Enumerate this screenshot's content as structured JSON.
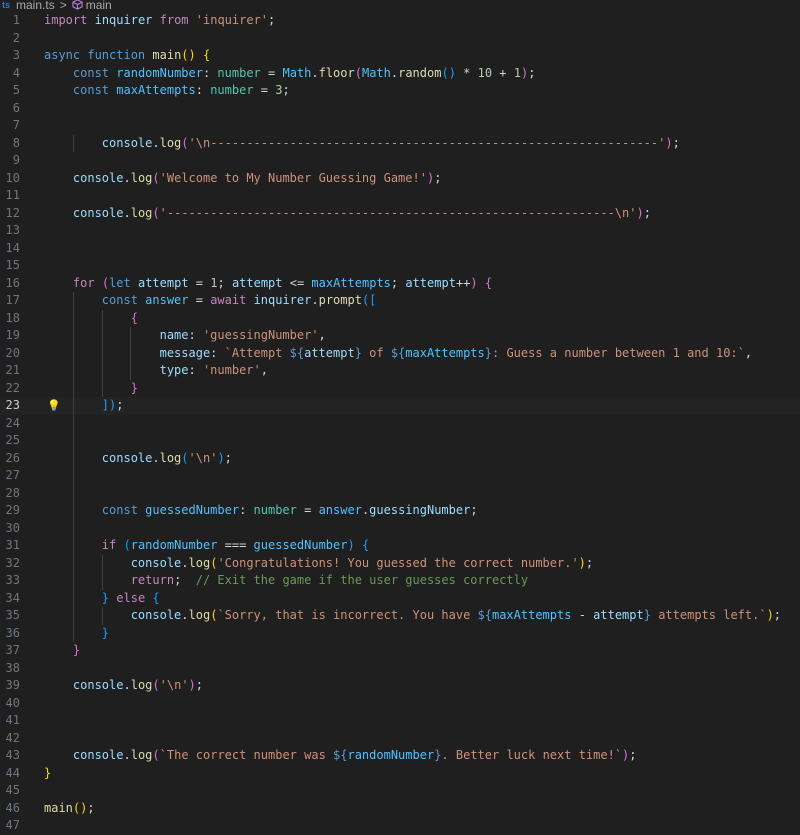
{
  "breadcrumb": {
    "file_icon": "ts",
    "file": "main.ts",
    "separator": ">",
    "symbol": "main"
  },
  "editor": {
    "current_line": 23,
    "lines": [
      {
        "n": "1",
        "tokens": [
          [
            "kw",
            "import"
          ],
          [
            "op",
            " "
          ],
          [
            "vr",
            "inquirer"
          ],
          [
            "op",
            " "
          ],
          [
            "kw",
            "from"
          ],
          [
            "op",
            " "
          ],
          [
            "str",
            "'inquirer'"
          ],
          [
            "op",
            ";"
          ]
        ]
      },
      {
        "n": "2",
        "tokens": []
      },
      {
        "n": "3",
        "tokens": [
          [
            "st",
            "async"
          ],
          [
            "op",
            " "
          ],
          [
            "st",
            "function"
          ],
          [
            "op",
            " "
          ],
          [
            "fn",
            "main"
          ],
          [
            "b1",
            "()"
          ],
          [
            "op",
            " "
          ],
          [
            "b1",
            "{"
          ]
        ]
      },
      {
        "n": "4",
        "tokens": [
          [
            "op",
            "    "
          ],
          [
            "st",
            "const"
          ],
          [
            "op",
            " "
          ],
          [
            "cn",
            "randomNumber"
          ],
          [
            "op",
            ": "
          ],
          [
            "ty",
            "number"
          ],
          [
            "op",
            " = "
          ],
          [
            "cn",
            "Math"
          ],
          [
            "op",
            "."
          ],
          [
            "fn",
            "floor"
          ],
          [
            "b2",
            "("
          ],
          [
            "cn",
            "Math"
          ],
          [
            "op",
            "."
          ],
          [
            "fn",
            "random"
          ],
          [
            "b3",
            "()"
          ],
          [
            "op",
            " * "
          ],
          [
            "num",
            "10"
          ],
          [
            "op",
            " + "
          ],
          [
            "num",
            "1"
          ],
          [
            "b2",
            ")"
          ],
          [
            "op",
            ";"
          ]
        ]
      },
      {
        "n": "5",
        "tokens": [
          [
            "op",
            "    "
          ],
          [
            "st",
            "const"
          ],
          [
            "op",
            " "
          ],
          [
            "cn",
            "maxAttempts"
          ],
          [
            "op",
            ": "
          ],
          [
            "ty",
            "number"
          ],
          [
            "op",
            " = "
          ],
          [
            "num",
            "3"
          ],
          [
            "op",
            ";"
          ]
        ]
      },
      {
        "n": "6",
        "tokens": []
      },
      {
        "n": "7",
        "tokens": []
      },
      {
        "n": "8",
        "tokens": [
          [
            "op",
            "        "
          ],
          [
            "vr",
            "console"
          ],
          [
            "op",
            "."
          ],
          [
            "fn",
            "log"
          ],
          [
            "b2",
            "("
          ],
          [
            "str",
            "'\\n--------------------------------------------------------------'"
          ],
          [
            "b2",
            ")"
          ],
          [
            "op",
            ";"
          ]
        ]
      },
      {
        "n": "9",
        "tokens": []
      },
      {
        "n": "10",
        "tokens": [
          [
            "op",
            "    "
          ],
          [
            "vr",
            "console"
          ],
          [
            "op",
            "."
          ],
          [
            "fn",
            "log"
          ],
          [
            "b2",
            "("
          ],
          [
            "str",
            "'Welcome to My Number Guessing Game!'"
          ],
          [
            "b2",
            ")"
          ],
          [
            "op",
            ";"
          ]
        ]
      },
      {
        "n": "11",
        "tokens": []
      },
      {
        "n": "12",
        "tokens": [
          [
            "op",
            "    "
          ],
          [
            "vr",
            "console"
          ],
          [
            "op",
            "."
          ],
          [
            "fn",
            "log"
          ],
          [
            "b2",
            "("
          ],
          [
            "str",
            "'--------------------------------------------------------------\\n'"
          ],
          [
            "b2",
            ")"
          ],
          [
            "op",
            ";"
          ]
        ]
      },
      {
        "n": "13",
        "tokens": []
      },
      {
        "n": "14",
        "tokens": []
      },
      {
        "n": "15",
        "tokens": []
      },
      {
        "n": "16",
        "tokens": [
          [
            "op",
            "    "
          ],
          [
            "kw",
            "for"
          ],
          [
            "op",
            " "
          ],
          [
            "b2",
            "("
          ],
          [
            "st",
            "let"
          ],
          [
            "op",
            " "
          ],
          [
            "vr",
            "attempt"
          ],
          [
            "op",
            " = "
          ],
          [
            "num",
            "1"
          ],
          [
            "op",
            "; "
          ],
          [
            "vr",
            "attempt"
          ],
          [
            "op",
            " <= "
          ],
          [
            "cn",
            "maxAttempts"
          ],
          [
            "op",
            "; "
          ],
          [
            "vr",
            "attempt"
          ],
          [
            "op",
            "++"
          ],
          [
            "b2",
            ")"
          ],
          [
            "op",
            " "
          ],
          [
            "b2",
            "{"
          ]
        ]
      },
      {
        "n": "17",
        "tokens": [
          [
            "op",
            "        "
          ],
          [
            "st",
            "const"
          ],
          [
            "op",
            " "
          ],
          [
            "cn",
            "answer"
          ],
          [
            "op",
            " = "
          ],
          [
            "kw",
            "await"
          ],
          [
            "op",
            " "
          ],
          [
            "vr",
            "inquirer"
          ],
          [
            "op",
            "."
          ],
          [
            "fn",
            "prompt"
          ],
          [
            "b3",
            "(["
          ]
        ]
      },
      {
        "n": "18",
        "tokens": [
          [
            "op",
            "            "
          ],
          [
            "b2",
            "{"
          ]
        ]
      },
      {
        "n": "19",
        "tokens": [
          [
            "op",
            "                "
          ],
          [
            "vr",
            "name"
          ],
          [
            "op",
            ": "
          ],
          [
            "str",
            "'guessingNumber'"
          ],
          [
            "op",
            ","
          ]
        ]
      },
      {
        "n": "20",
        "tokens": [
          [
            "op",
            "                "
          ],
          [
            "vr",
            "message"
          ],
          [
            "op",
            ": "
          ],
          [
            "str",
            "`Attempt "
          ],
          [
            "st",
            "${"
          ],
          [
            "vr",
            "attempt"
          ],
          [
            "st",
            "}"
          ],
          [
            "str",
            " of "
          ],
          [
            "st",
            "${"
          ],
          [
            "cn",
            "maxAttempts"
          ],
          [
            "st",
            "}"
          ],
          [
            "str",
            ": Guess a number between 1 and 10:`"
          ],
          [
            "op",
            ","
          ]
        ]
      },
      {
        "n": "21",
        "tokens": [
          [
            "op",
            "                "
          ],
          [
            "vr",
            "type"
          ],
          [
            "op",
            ": "
          ],
          [
            "str",
            "'number'"
          ],
          [
            "op",
            ","
          ]
        ]
      },
      {
        "n": "22",
        "tokens": [
          [
            "op",
            "            "
          ],
          [
            "b2",
            "}"
          ]
        ]
      },
      {
        "n": "23",
        "tokens": [
          [
            "op",
            "        "
          ],
          [
            "b3",
            "])"
          ],
          [
            "op",
            ";"
          ]
        ]
      },
      {
        "n": "24",
        "tokens": []
      },
      {
        "n": "25",
        "tokens": []
      },
      {
        "n": "26",
        "tokens": [
          [
            "op",
            "        "
          ],
          [
            "vr",
            "console"
          ],
          [
            "op",
            "."
          ],
          [
            "fn",
            "log"
          ],
          [
            "b3",
            "("
          ],
          [
            "str",
            "'\\n'"
          ],
          [
            "b3",
            ")"
          ],
          [
            "op",
            ";"
          ]
        ]
      },
      {
        "n": "27",
        "tokens": []
      },
      {
        "n": "28",
        "tokens": []
      },
      {
        "n": "29",
        "tokens": [
          [
            "op",
            "        "
          ],
          [
            "st",
            "const"
          ],
          [
            "op",
            " "
          ],
          [
            "cn",
            "guessedNumber"
          ],
          [
            "op",
            ": "
          ],
          [
            "ty",
            "number"
          ],
          [
            "op",
            " = "
          ],
          [
            "cn",
            "answer"
          ],
          [
            "op",
            "."
          ],
          [
            "vr",
            "guessingNumber"
          ],
          [
            "op",
            ";"
          ]
        ]
      },
      {
        "n": "30",
        "tokens": []
      },
      {
        "n": "31",
        "tokens": [
          [
            "op",
            "        "
          ],
          [
            "kw",
            "if"
          ],
          [
            "op",
            " "
          ],
          [
            "b3",
            "("
          ],
          [
            "cn",
            "randomNumber"
          ],
          [
            "op",
            " === "
          ],
          [
            "cn",
            "guessedNumber"
          ],
          [
            "b3",
            ")"
          ],
          [
            "op",
            " "
          ],
          [
            "b3",
            "{"
          ]
        ]
      },
      {
        "n": "32",
        "tokens": [
          [
            "op",
            "            "
          ],
          [
            "vr",
            "console"
          ],
          [
            "op",
            "."
          ],
          [
            "fn",
            "log"
          ],
          [
            "b1",
            "("
          ],
          [
            "str",
            "'Congratulations! You guessed the correct number.'"
          ],
          [
            "b1",
            ")"
          ],
          [
            "op",
            ";"
          ]
        ]
      },
      {
        "n": "33",
        "tokens": [
          [
            "op",
            "            "
          ],
          [
            "kw",
            "return"
          ],
          [
            "op",
            ";  "
          ],
          [
            "cm",
            "// Exit the game if the user guesses correctly"
          ]
        ]
      },
      {
        "n": "34",
        "tokens": [
          [
            "op",
            "        "
          ],
          [
            "b3",
            "}"
          ],
          [
            "op",
            " "
          ],
          [
            "kw",
            "else"
          ],
          [
            "op",
            " "
          ],
          [
            "b3",
            "{"
          ]
        ]
      },
      {
        "n": "35",
        "tokens": [
          [
            "op",
            "            "
          ],
          [
            "vr",
            "console"
          ],
          [
            "op",
            "."
          ],
          [
            "fn",
            "log"
          ],
          [
            "b1",
            "("
          ],
          [
            "str",
            "`Sorry, that is incorrect. You have "
          ],
          [
            "st",
            "${"
          ],
          [
            "cn",
            "maxAttempts"
          ],
          [
            "op",
            " - "
          ],
          [
            "vr",
            "attempt"
          ],
          [
            "st",
            "}"
          ],
          [
            "str",
            " attempts left.`"
          ],
          [
            "b1",
            ")"
          ],
          [
            "op",
            ";"
          ]
        ]
      },
      {
        "n": "36",
        "tokens": [
          [
            "op",
            "        "
          ],
          [
            "b3",
            "}"
          ]
        ]
      },
      {
        "n": "37",
        "tokens": [
          [
            "op",
            "    "
          ],
          [
            "b2",
            "}"
          ]
        ]
      },
      {
        "n": "38",
        "tokens": []
      },
      {
        "n": "39",
        "tokens": [
          [
            "op",
            "    "
          ],
          [
            "vr",
            "console"
          ],
          [
            "op",
            "."
          ],
          [
            "fn",
            "log"
          ],
          [
            "b2",
            "("
          ],
          [
            "str",
            "'\\n'"
          ],
          [
            "b2",
            ")"
          ],
          [
            "op",
            ";"
          ]
        ]
      },
      {
        "n": "40",
        "tokens": []
      },
      {
        "n": "41",
        "tokens": []
      },
      {
        "n": "42",
        "tokens": []
      },
      {
        "n": "43",
        "tokens": [
          [
            "op",
            "    "
          ],
          [
            "vr",
            "console"
          ],
          [
            "op",
            "."
          ],
          [
            "fn",
            "log"
          ],
          [
            "b2",
            "("
          ],
          [
            "str",
            "`The correct number was "
          ],
          [
            "st",
            "${"
          ],
          [
            "cn",
            "randomNumber"
          ],
          [
            "st",
            "}"
          ],
          [
            "str",
            ". Better luck next time!`"
          ],
          [
            "b2",
            ")"
          ],
          [
            "op",
            ";"
          ]
        ]
      },
      {
        "n": "44",
        "tokens": [
          [
            "b1",
            "}"
          ]
        ]
      },
      {
        "n": "45",
        "tokens": []
      },
      {
        "n": "46",
        "tokens": [
          [
            "fn",
            "main"
          ],
          [
            "b1",
            "()"
          ],
          [
            "op",
            ";"
          ]
        ]
      },
      {
        "n": "47",
        "tokens": []
      }
    ]
  }
}
